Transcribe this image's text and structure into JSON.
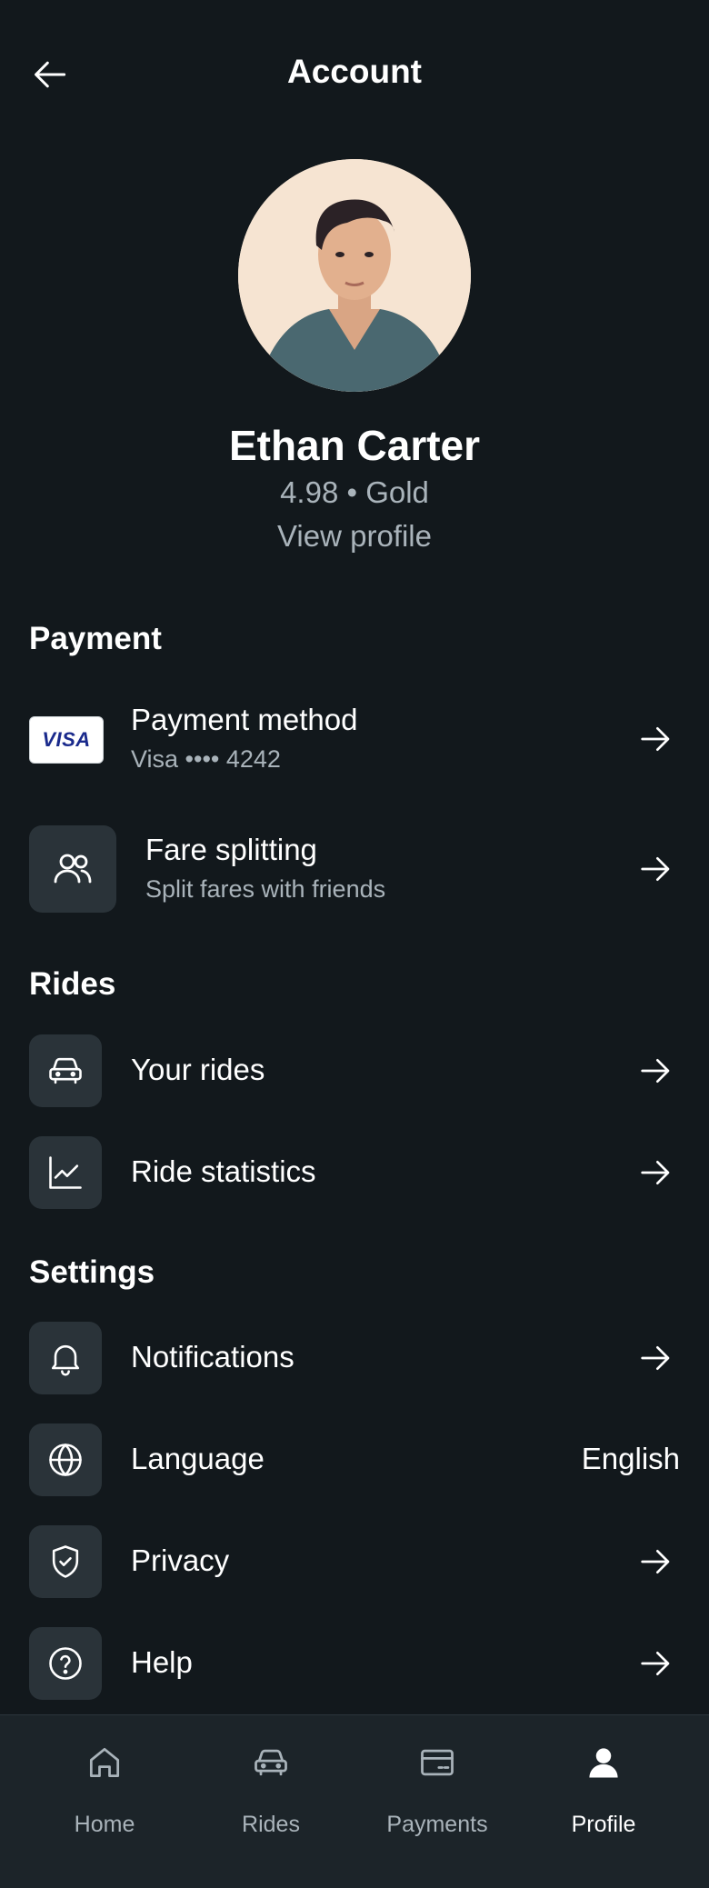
{
  "header": {
    "title": "Account",
    "back_icon": "arrow-left-icon"
  },
  "profile": {
    "name": "Ethan Carter",
    "rating": "4.98 • Gold",
    "view_profile": "View profile"
  },
  "sections": {
    "payment": {
      "title": "Payment",
      "items": [
        {
          "label": "Payment method",
          "sublabel": "Visa •••• 4242",
          "icon": "visa-card-icon",
          "card_brand": "VISA"
        },
        {
          "label": "Fare splitting",
          "sublabel": "Split fares with friends",
          "icon": "users-icon"
        }
      ]
    },
    "rides": {
      "title": "Rides",
      "items": [
        {
          "label": "Your rides",
          "icon": "car-icon"
        },
        {
          "label": "Ride statistics",
          "icon": "line-chart-icon"
        }
      ]
    },
    "settings": {
      "title": "Settings",
      "items": [
        {
          "label": "Notifications",
          "icon": "bell-icon"
        },
        {
          "label": "Language",
          "value": "English",
          "icon": "globe-icon"
        },
        {
          "label": "Privacy",
          "icon": "shield-check-icon"
        },
        {
          "label": "Help",
          "icon": "help-circle-icon"
        }
      ]
    }
  },
  "bottom_nav": {
    "items": [
      {
        "label": "Home",
        "icon": "home-icon"
      },
      {
        "label": "Rides",
        "icon": "car-icon"
      },
      {
        "label": "Payments",
        "icon": "credit-card-icon"
      },
      {
        "label": "Profile",
        "icon": "user-icon",
        "active": true
      }
    ]
  },
  "colors": {
    "background": "#12181c",
    "icon_tile": "#2a3339",
    "secondary_text": "#a9b3ba",
    "nav_background": "#1c2429"
  }
}
